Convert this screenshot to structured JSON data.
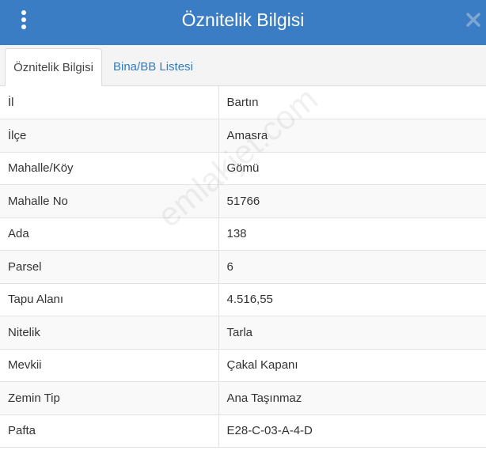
{
  "window": {
    "title": "Öznitelik Bilgisi"
  },
  "tabs": [
    {
      "label": "Öznitelik Bilgisi",
      "active": true
    },
    {
      "label": "Bina/BB Listesi",
      "active": false
    }
  ],
  "rows": [
    {
      "key": "İl",
      "value": "Bartın"
    },
    {
      "key": "İlçe",
      "value": "Amasra"
    },
    {
      "key": "Mahalle/Köy",
      "value": "Gömü"
    },
    {
      "key": "Mahalle No",
      "value": "51766"
    },
    {
      "key": "Ada",
      "value": "138"
    },
    {
      "key": "Parsel",
      "value": "6"
    },
    {
      "key": "Tapu Alanı",
      "value": "4.516,55"
    },
    {
      "key": "Nitelik",
      "value": "Tarla"
    },
    {
      "key": "Mevkii",
      "value": "Çakal Kapanı"
    },
    {
      "key": "Zemin Tip",
      "value": "Ana Taşınmaz"
    },
    {
      "key": "Pafta",
      "value": "E28-C-03-A-4-D"
    }
  ],
  "watermark": "emlakjet.com",
  "colors": {
    "header": "#3a7dc4",
    "tab_link": "#2f7bbf"
  },
  "icons": {
    "menu": "vertical-dots-icon",
    "close": "close-icon"
  }
}
